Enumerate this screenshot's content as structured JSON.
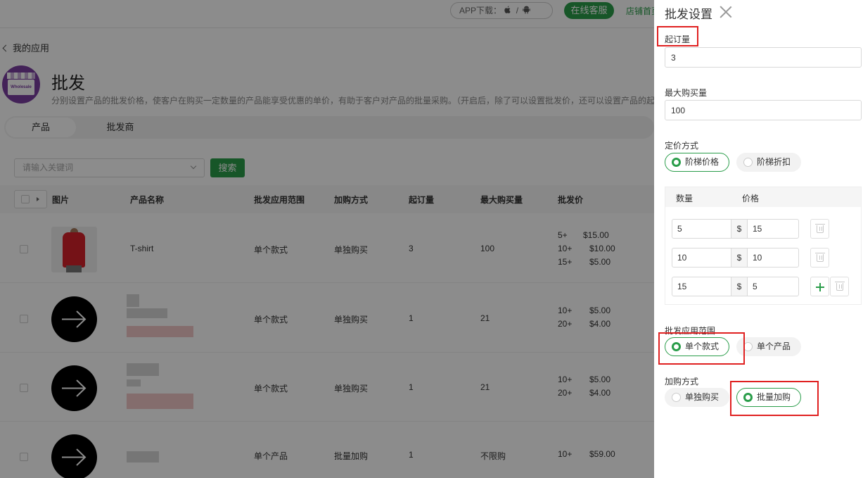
{
  "topbar": {
    "app_download_label": "APP下载：",
    "app_separator": "/",
    "service_button": "在线客服",
    "shop_home_link": "店铺首页"
  },
  "breadcrumb": {
    "back_label": "我的应用"
  },
  "app": {
    "logo_text": "Wholesale",
    "title": "批发",
    "description": "分别设置产品的批发价格，使客户在购买一定数量的产品能享受优惠的单价，有助于客户对产品的批量采购。（开启后，除了可以设置批发价，还可以设置产品的起订量"
  },
  "tabs": [
    {
      "label": "产品",
      "active": true
    },
    {
      "label": "批发商",
      "active": false
    }
  ],
  "search": {
    "placeholder": "请输入关键词",
    "button_label": "搜索"
  },
  "table": {
    "columns": [
      "图片",
      "产品名称",
      "批发应用范围",
      "加购方式",
      "起订量",
      "最大购买量",
      "批发价"
    ],
    "rows": [
      {
        "name": "T-shirt",
        "scope": "单个款式",
        "add_method": "单独购买",
        "moq": "3",
        "max_qty": "100",
        "prices": [
          {
            "qty": "5+",
            "price": "$15.00"
          },
          {
            "qty": "10+",
            "price": "$10.00"
          },
          {
            "qty": "15+",
            "price": "$5.00"
          }
        ]
      },
      {
        "name": "",
        "scope": "单个款式",
        "add_method": "单独购买",
        "moq": "1",
        "max_qty": "21",
        "prices": [
          {
            "qty": "10+",
            "price": "$5.00"
          },
          {
            "qty": "20+",
            "price": "$4.00"
          }
        ]
      },
      {
        "name": "",
        "scope": "单个款式",
        "add_method": "单独购买",
        "moq": "1",
        "max_qty": "21",
        "prices": [
          {
            "qty": "10+",
            "price": "$5.00"
          },
          {
            "qty": "20+",
            "price": "$4.00"
          }
        ]
      },
      {
        "name": "",
        "scope": "单个产品",
        "add_method": "批量加购",
        "moq": "1",
        "max_qty": "不限购",
        "prices": [
          {
            "qty": "10+",
            "price": "$59.00"
          }
        ]
      }
    ]
  },
  "drawer": {
    "title": "批发设置",
    "moq_label": "起订量",
    "moq_value": "3",
    "max_label": "最大购买量",
    "max_value": "100",
    "pricing_label": "定价方式",
    "pricing_options": [
      {
        "label": "阶梯价格",
        "selected": true
      },
      {
        "label": "阶梯折扣",
        "selected": false
      }
    ],
    "tier_headers": {
      "qty": "数量",
      "price": "价格"
    },
    "currency_symbol": "$",
    "tiers": [
      {
        "qty": "5",
        "price": "15"
      },
      {
        "qty": "10",
        "price": "10"
      },
      {
        "qty": "15",
        "price": "5"
      }
    ],
    "scope_label": "批发应用范围",
    "scope_options": [
      {
        "label": "单个款式",
        "selected": true
      },
      {
        "label": "单个产品",
        "selected": false
      }
    ],
    "add_label": "加购方式",
    "add_options": [
      {
        "label": "单独购买",
        "selected": false
      },
      {
        "label": "批量加购",
        "selected": true
      }
    ]
  },
  "colors": {
    "brand_green": "#2a9d4a",
    "highlight_red": "#e02020",
    "logo_purple": "#7b3fa0"
  }
}
